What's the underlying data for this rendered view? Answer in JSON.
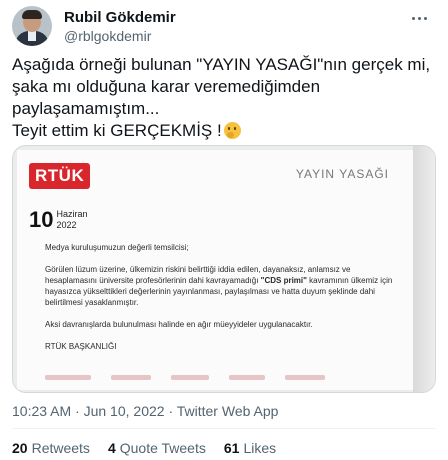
{
  "user": {
    "display_name": "Rubil Gökdemir",
    "handle": "@rblgokdemir"
  },
  "tweet": {
    "lines": [
      "Aşağıda örneği bulunan \"YAYIN YASAĞI\"nın gerçek mi,",
      "şaka mı olduğuna karar veremediğimden",
      "paylaşamamıştım...",
      "Teyit ettim ki GERÇEKMİŞ !"
    ],
    "emoji": "thinking-face"
  },
  "document": {
    "logo_text": "RTÜK",
    "title": "YAYIN YASAĞI",
    "day": "10",
    "month": "Haziran",
    "year": "2022",
    "greeting": "Medya kuruluşumuzun değerli temsilcisi;",
    "para1_a": "Görülen lüzum üzerine, ülkemizin riskini belirttiği iddia edilen, dayanaksız, anlamsız ve hesaplamasını üniversite profesörlerinin dahi kavrayamadığı ",
    "para1_bold": "\"CDS primi\"",
    "para1_b": " kavramının ülkemiz için hayasızca yükselttikleri değerlerinin yayınlanması, paylaşılması ve hatta duyum şeklinde dahi belirtilmesi yasaklanmıştır.",
    "para2": "Aksi davranışlarda bulunulması halinde en ağır müeyyideler uygulanacaktır.",
    "signature": "RTÜK BAŞKANLIĞI"
  },
  "meta": {
    "timestamp": "10:23 AM · Jun 10, 2022 · Twitter Web App"
  },
  "stats": {
    "retweets_count": "20",
    "retweets_label": "Retweets",
    "quotes_count": "4",
    "quotes_label": "Quote Tweets",
    "likes_count": "61",
    "likes_label": "Likes"
  },
  "colors": {
    "logo_red": "#d9262c",
    "muted": "#536471"
  }
}
